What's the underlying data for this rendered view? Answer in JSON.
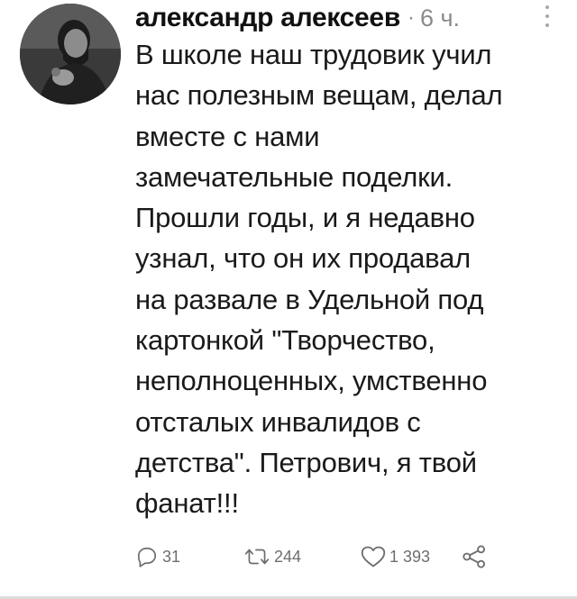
{
  "tweet": {
    "author": "александр алексеев",
    "separator": "·",
    "time": "6 ч.",
    "text_lines": [
      "В школе наш трудовик учил",
      "нас полезным вещам, делал",
      "вместе с нами",
      "замечательные поделки.",
      "Прошли годы, и я недавно",
      "узнал, что он их продавал",
      "на развале в Удельной под",
      "картонкой \"Творчество,",
      "неполноценных, умственно",
      "отсталых инвалидов с",
      "детства\". Петрович, я твой",
      "фанат!!!"
    ]
  },
  "actions": {
    "replies": "31",
    "retweets": "244",
    "likes": "1 393"
  },
  "icons": {
    "reply": "reply-icon",
    "retweet": "retweet-icon",
    "like": "heart-icon",
    "share": "share-icon",
    "more": "more-vertical-icon"
  },
  "colors": {
    "text": "#1a1a1a",
    "muted": "#6e6e6e"
  }
}
